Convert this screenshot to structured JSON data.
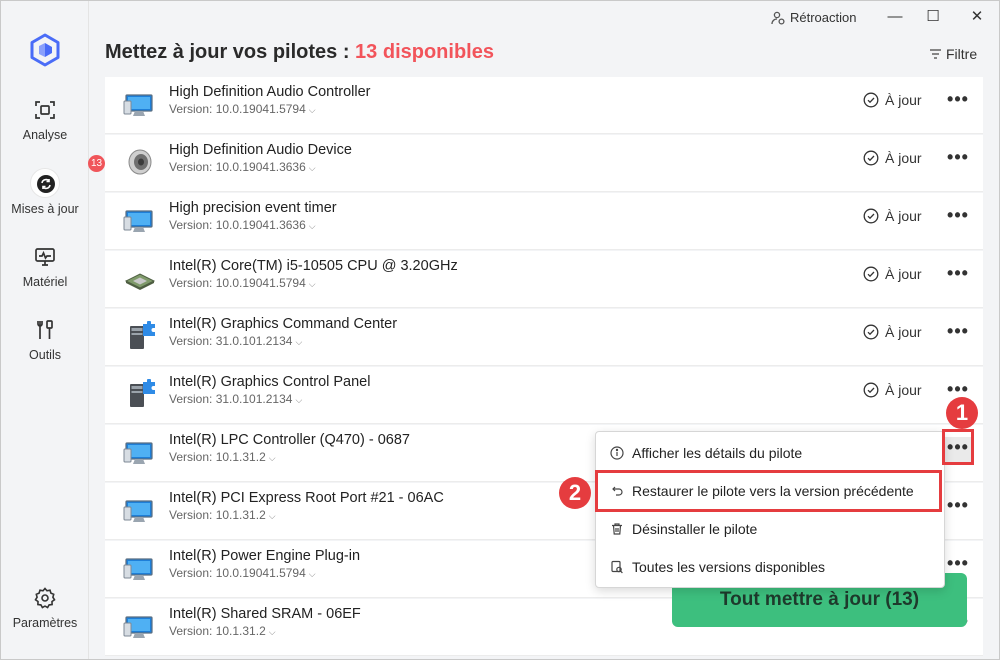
{
  "window": {
    "feedback_label": "Rétroaction",
    "minimize": "—",
    "maximize": "☐",
    "close": "✕"
  },
  "sidebar": {
    "items": [
      {
        "label": "Analyse",
        "icon": "scan-icon"
      },
      {
        "label": "Mises à jour",
        "icon": "refresh-icon",
        "badge": "13"
      },
      {
        "label": "Matériel",
        "icon": "monitor-icon"
      },
      {
        "label": "Outils",
        "icon": "tools-icon"
      }
    ],
    "settings_label": "Paramètres"
  },
  "header": {
    "title": "Mettez à jour vos pilotes : ",
    "count_text": "13 disponibles",
    "filter_label": "Filtre"
  },
  "drivers": [
    {
      "name": "High Definition Audio Controller",
      "version": "Version: 10.0.19041.5794",
      "status": "À jour",
      "icon": "monitor-icon"
    },
    {
      "name": "High Definition Audio Device",
      "version": "Version: 10.0.19041.3636",
      "status": "À jour",
      "icon": "speaker-icon"
    },
    {
      "name": "High precision event timer",
      "version": "Version: 10.0.19041.3636",
      "status": "À jour",
      "icon": "monitor-icon"
    },
    {
      "name": "Intel(R) Core(TM) i5-10505 CPU @ 3.20GHz",
      "version": "Version: 10.0.19041.5794",
      "status": "À jour",
      "icon": "cpu-icon"
    },
    {
      "name": "Intel(R) Graphics Command Center",
      "version": "Version: 31.0.101.2134",
      "status": "À jour",
      "icon": "server-puzzle-icon"
    },
    {
      "name": "Intel(R) Graphics Control Panel",
      "version": "Version: 31.0.101.2134",
      "status": "À jour",
      "icon": "server-puzzle-icon"
    },
    {
      "name": "Intel(R) LPC Controller (Q470) - 0687",
      "version": "Version: 10.1.31.2",
      "status": "",
      "icon": "monitor-icon"
    },
    {
      "name": "Intel(R) PCI Express Root Port #21 - 06AC",
      "version": "Version: 10.1.31.2",
      "status": "",
      "icon": "monitor-icon"
    },
    {
      "name": "Intel(R) Power Engine Plug-in",
      "version": "Version: 10.0.19041.5794",
      "status": "",
      "icon": "monitor-icon"
    },
    {
      "name": "Intel(R) Shared SRAM - 06EF",
      "version": "Version: 10.1.31.2",
      "status": "",
      "icon": "monitor-icon"
    }
  ],
  "context_menu": {
    "items": [
      {
        "label": "Afficher les détails du pilote",
        "icon": "info-icon"
      },
      {
        "label": "Restaurer le pilote vers la version précédente",
        "icon": "undo-icon"
      },
      {
        "label": "Désinstaller le pilote",
        "icon": "trash-icon"
      },
      {
        "label": "Toutes les versions disponibles",
        "icon": "versions-icon"
      }
    ]
  },
  "update_all_label": "Tout mettre à jour (13)",
  "annotations": {
    "marker1": "1",
    "marker2": "2"
  },
  "colors": {
    "accent_red": "#f2545b",
    "update_green": "#3dbf7e",
    "highlight": "#e53c3f",
    "brand_blue": "#4a6cf7"
  }
}
